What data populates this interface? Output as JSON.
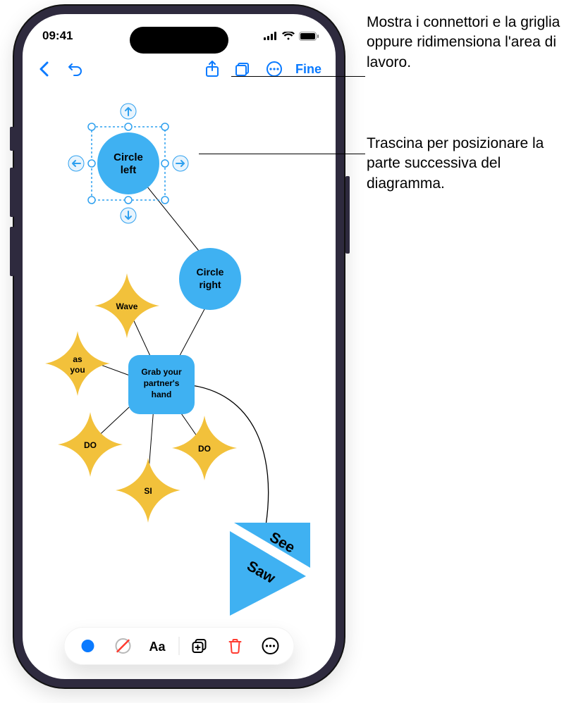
{
  "status": {
    "time": "09:41"
  },
  "toolbar": {
    "done": "Fine"
  },
  "nodes": {
    "circle_left_l1": "Circle",
    "circle_left_l2": "left",
    "circle_right_l1": "Circle",
    "circle_right_l2": "right",
    "grab_l1": "Grab your",
    "grab_l2": "partner's",
    "grab_l3": "hand",
    "wave": "Wave",
    "as_l1": "as",
    "as_l2": "you",
    "do1": "DO",
    "si": "SI",
    "do2": "DO",
    "see": "See",
    "saw": "Saw"
  },
  "callouts": {
    "c1": "Mostra i connettori e la griglia oppure ridimensiona l'area di lavoro.",
    "c2": "Trascina per posizionare la parte successiva del diagramma."
  },
  "colors": {
    "blue": "#3fb1f2",
    "yellow": "#f2c13b",
    "select": "#2ea0ef",
    "accent": "#0a7aff",
    "red": "#ff3b30"
  }
}
